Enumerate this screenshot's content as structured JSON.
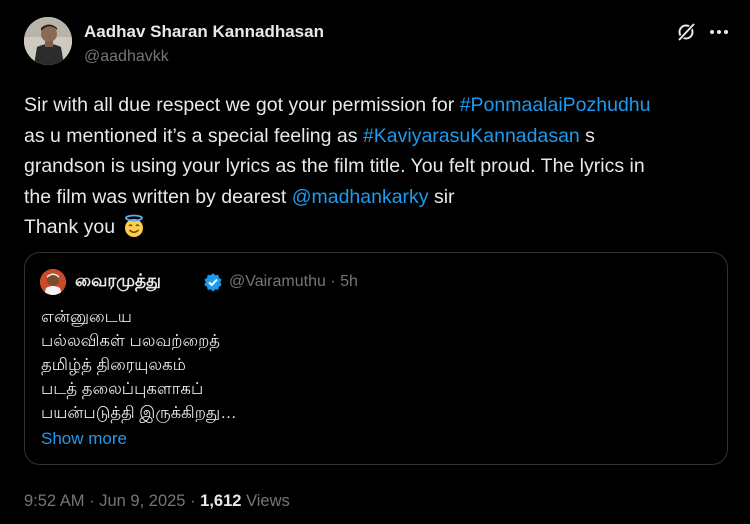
{
  "author": {
    "name": "Aadhav Sharan Kannadhasan",
    "handle": "@aadhavkk"
  },
  "post": {
    "lines": [
      {
        "before": "Sir with all due respect we got your permission for ",
        "link": "#PonmaalaiPozhudhu",
        "after": ""
      },
      {
        "before": "as u mentioned it’s a special feeling as ",
        "link": "#KaviyarasuKannadasan",
        "after": " s"
      },
      {
        "before": "grandson is using your lyrics as the film title. You felt proud. The lyrics in",
        "link": "",
        "after": ""
      },
      {
        "before": "the film was written by dearest ",
        "link": "@madhankarky",
        "after": " sir"
      },
      {
        "before": "Thank you ",
        "link": "",
        "after": ""
      }
    ],
    "emoji": "smiling-face-with-halo"
  },
  "quote": {
    "name": "வைரமுத்து",
    "handle": "@Vairamuthu",
    "separator": "·",
    "time": "5h",
    "lines": [
      "என்னுடைய",
      "பல்லவிகள் பலவற்றைத்",
      "தமிழ்த் திரையுலகம்",
      "படத் தலைப்புகளாகப்",
      "பயன்படுத்தி இருக்கிறது…"
    ],
    "show_more": "Show more"
  },
  "meta": {
    "time": "9:52 AM",
    "sep1": "·",
    "date": "Jun 9, 2025",
    "sep2": "·",
    "views_count": "1,612",
    "views_label": "Views"
  },
  "colors": {
    "background": "#000000",
    "text": "#e7e9ea",
    "secondary": "#71767b",
    "link": "#1d9bf0",
    "border": "#2f3336"
  }
}
